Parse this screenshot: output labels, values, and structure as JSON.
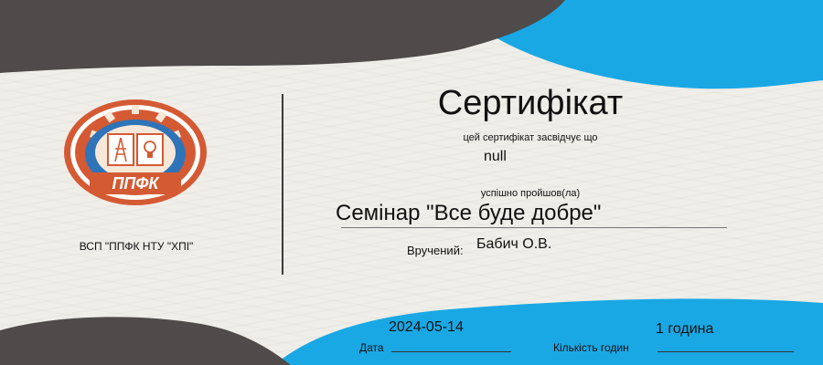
{
  "certificate": {
    "title": "Сертифікат",
    "certifies_text": "цей сертифікат засвідчує що",
    "recipient_name": "null",
    "completed_text": "успішно пройшов(ла)",
    "course_name": "Семінар \"Все буде добре\"",
    "issued_label": "Вручений:",
    "issuer_name": "Бабич О.В.",
    "date_value": "2024-05-14",
    "date_label": "Дата",
    "duration_value": "1 година",
    "duration_label": "Кількість годин"
  },
  "organization": {
    "name": "ВСП \"ППФК НТУ \"ХПІ\"",
    "logo_text": "ППФК",
    "logo_icon": "college-emblem-icon"
  },
  "colors": {
    "dark_gray": "#4e4b4a",
    "sky_blue": "#1aa8e4",
    "logo_orange": "#d45a33",
    "logo_blue": "#2f73b8"
  }
}
